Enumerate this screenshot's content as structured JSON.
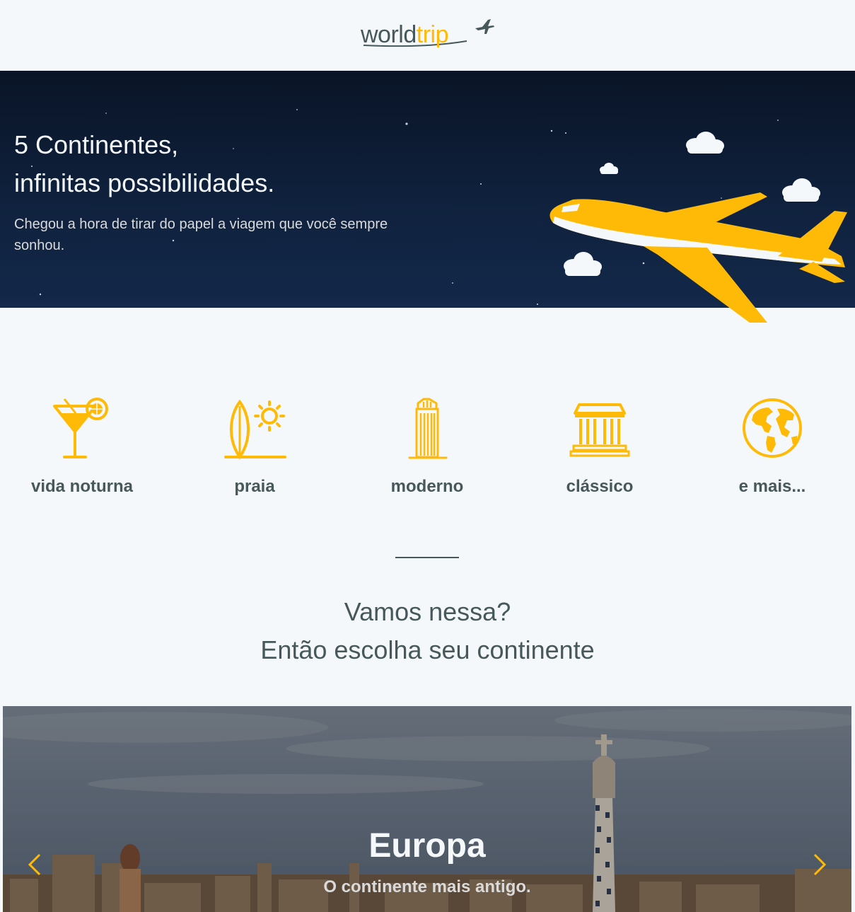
{
  "header": {
    "logo_world": "world",
    "logo_trip": "trip"
  },
  "banner": {
    "title_line1": "5 Continentes,",
    "title_line2": "infinitas possibilidades.",
    "subtitle": "Chegou a hora de tirar do papel a viagem que você sempre sonhou."
  },
  "travel_types": [
    {
      "label": "vida noturna",
      "icon": "cocktail-icon"
    },
    {
      "label": "praia",
      "icon": "surf-sun-icon"
    },
    {
      "label": "moderno",
      "icon": "building-icon"
    },
    {
      "label": "clássico",
      "icon": "museum-icon"
    },
    {
      "label": "e mais...",
      "icon": "earth-icon"
    }
  ],
  "cta": {
    "line1": "Vamos nessa?",
    "line2": "Então escolha seu continente"
  },
  "carousel": {
    "title": "Europa",
    "subtitle": "O continente mais antigo."
  },
  "colors": {
    "accent": "#FFBA08",
    "text": "#47585B",
    "background": "#F5F8FA",
    "banner": "#0F213D"
  }
}
